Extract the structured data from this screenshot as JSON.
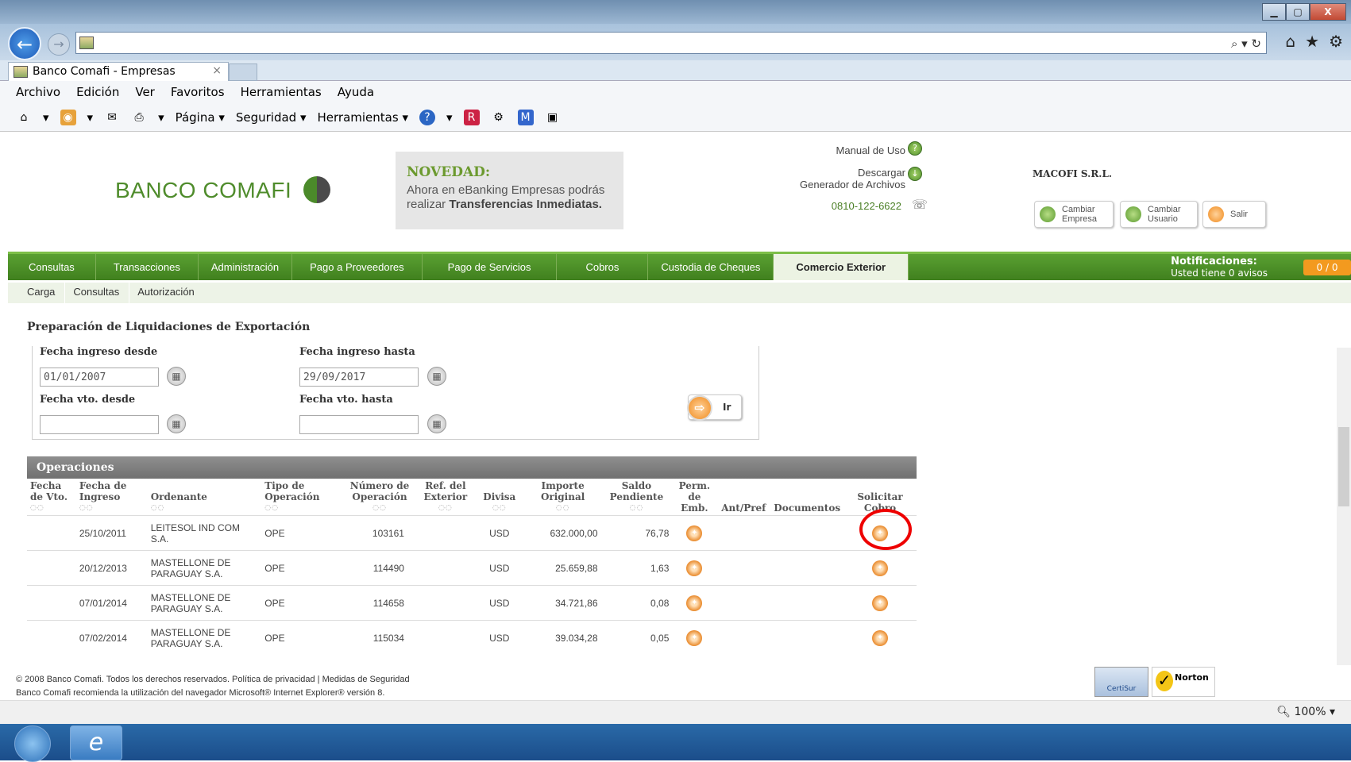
{
  "browser": {
    "tab_title": "Banco Comafi - Empresas",
    "tab_close": "×",
    "search_glyph": "⌕ ▾ ↻",
    "menu": [
      "Archivo",
      "Edición",
      "Ver",
      "Favoritos",
      "Herramientas",
      "Ayuda"
    ],
    "commands": {
      "page": "Página ▾",
      "security": "Seguridad ▾",
      "tools": "Herramientas ▾"
    },
    "zoom": "100%",
    "window_controls": {
      "minimize": "▁",
      "maximize": "▢",
      "close": "X"
    }
  },
  "bank": {
    "logo_text": "BANCO COMAFI",
    "novedad_title": "NOVEDAD:",
    "novedad_text_1": "Ahora en eBanking Empresas podrás",
    "novedad_text_2": "realizar",
    "novedad_bold": "Transferencias Inmediatas.",
    "manual": "Manual de Uso",
    "download_1": "Descargar",
    "download_2": "Generador de Archivos",
    "phone": "0810-122-6622",
    "company": "MACOFI S.R.L.",
    "btn_change_company_1": "Cambiar",
    "btn_change_company_2": "Empresa",
    "btn_change_user_1": "Cambiar",
    "btn_change_user_2": "Usuario",
    "btn_exit": "Salir"
  },
  "nav": {
    "items": [
      "Consultas",
      "Transacciones",
      "Administración",
      "Pago a Proveedores",
      "Pago de Servicios",
      "Cobros",
      "Custodia de Cheques",
      "Comercio Exterior"
    ],
    "notif_title": "Notificaciones:",
    "notif_text": "Usted tiene 0 avisos",
    "notif_badge": "0 / 0",
    "sub": [
      "Carga",
      "Consultas",
      "Autorización"
    ]
  },
  "form": {
    "title": "Preparación de Liquidaciones de Exportación",
    "date_from_label": "Fecha ingreso desde",
    "date_from_value": "01/01/2007",
    "date_to_label": "Fecha ingreso hasta",
    "date_to_value": "29/09/2017",
    "due_from_label": "Fecha vto. desde",
    "due_to_label": "Fecha vto. hasta",
    "go_label": "Ir"
  },
  "operations": {
    "title": "Operaciones",
    "columns": [
      [
        "Fecha",
        "de Vto."
      ],
      [
        "Fecha de",
        "Ingreso"
      ],
      [
        "",
        "Ordenante"
      ],
      [
        "Tipo de",
        "Operación"
      ],
      [
        "Número de",
        "Operación"
      ],
      [
        "Ref. del",
        "Exterior"
      ],
      [
        "",
        "Divisa"
      ],
      [
        "Importe",
        "Original"
      ],
      [
        "Saldo",
        "Pendiente"
      ],
      [
        "Perm.",
        "de Emb."
      ],
      [
        "",
        "Ant/Pref"
      ],
      [
        "",
        "Documentos"
      ],
      [
        "Solicitar",
        "Cobro"
      ]
    ],
    "rows": [
      {
        "vto": "",
        "ingreso": "25/10/2011",
        "ordenante_1": "LEITESOL IND COM",
        "ordenante_2": "S.A.",
        "tipo": "OPE",
        "numero": "103161",
        "ref": "",
        "divisa": "USD",
        "importe": "632.000,00",
        "saldo": "76,78"
      },
      {
        "vto": "",
        "ingreso": "20/12/2013",
        "ordenante_1": "MASTELLONE DE",
        "ordenante_2": "PARAGUAY S.A.",
        "tipo": "OPE",
        "numero": "114490",
        "ref": "",
        "divisa": "USD",
        "importe": "25.659,88",
        "saldo": "1,63"
      },
      {
        "vto": "",
        "ingreso": "07/01/2014",
        "ordenante_1": "MASTELLONE DE",
        "ordenante_2": "PARAGUAY S.A.",
        "tipo": "OPE",
        "numero": "114658",
        "ref": "",
        "divisa": "USD",
        "importe": "34.721,86",
        "saldo": "0,08"
      },
      {
        "vto": "",
        "ingreso": "07/02/2014",
        "ordenante_1": "MASTELLONE DE",
        "ordenante_2": "PARAGUAY S.A.",
        "tipo": "OPE",
        "numero": "115034",
        "ref": "",
        "divisa": "USD",
        "importe": "39.034,28",
        "saldo": "0,05"
      }
    ]
  },
  "footer": {
    "line1": "© 2008 Banco Comafi. Todos los derechos reservados. Política de privacidad  |  Medidas de Seguridad",
    "line2": "Banco Comafi recomienda la utilización del navegador Microsoft® Internet Explorer® versión 8.",
    "seal1": "CertiSur",
    "seal2": "Norton"
  }
}
